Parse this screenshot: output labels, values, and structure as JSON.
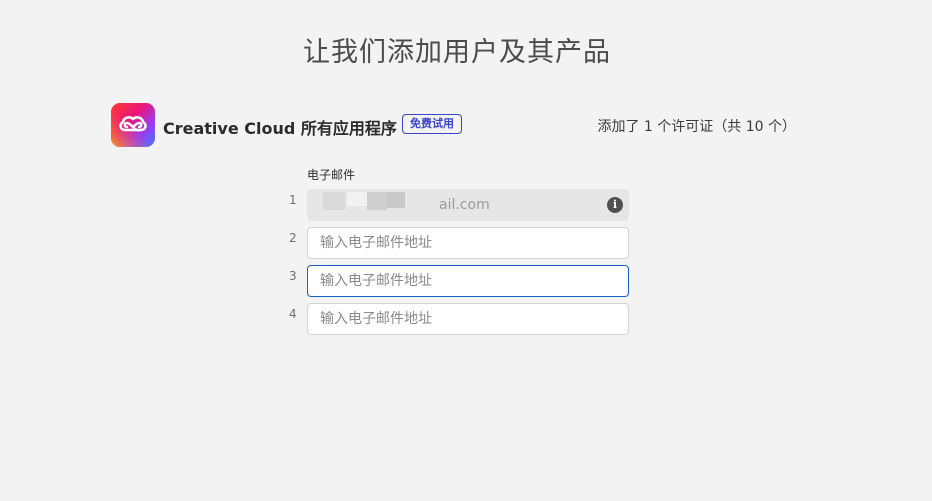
{
  "page": {
    "title": "让我们添加用户及其产品"
  },
  "product": {
    "icon": "creative-cloud-icon",
    "name": "Creative Cloud 所有应用程序",
    "badge": "免费试用",
    "license_count": "添加了 1 个许可证（共 10 个）"
  },
  "form": {
    "email_label": "电子邮件",
    "rows": [
      {
        "number": "1",
        "value": "ail.com",
        "placeholder": "",
        "state": "disabled",
        "info_icon": "info-icon"
      },
      {
        "number": "2",
        "value": "",
        "placeholder": "输入电子邮件地址",
        "state": "default"
      },
      {
        "number": "3",
        "value": "",
        "placeholder": "输入电子邮件地址",
        "state": "focused"
      },
      {
        "number": "4",
        "value": "",
        "placeholder": "输入电子邮件地址",
        "state": "default"
      }
    ]
  },
  "colors": {
    "background": "#f3f3f3",
    "badge_accent": "#3a45c8",
    "focus_border": "#1a5fc7",
    "disabled_field": "#e6e6e6"
  }
}
